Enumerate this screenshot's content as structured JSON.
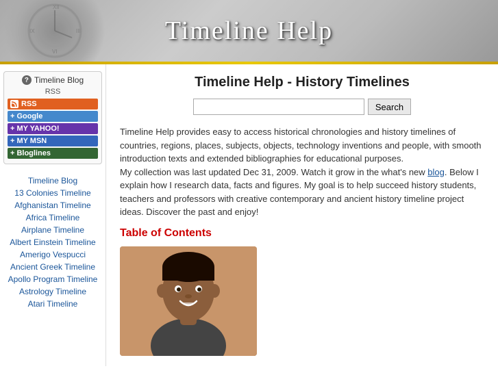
{
  "header": {
    "title": "Timeline Help"
  },
  "sidebar": {
    "blog_box_title": "Timeline Blog",
    "blog_box_subtitle": "RSS",
    "buttons": [
      {
        "label": "RSS",
        "class": "btn-rss",
        "prefix": ""
      },
      {
        "label": "Google",
        "class": "btn-google",
        "prefix": "+ "
      },
      {
        "label": "MY YAHOO!",
        "class": "btn-yahoo",
        "prefix": "+ "
      },
      {
        "label": "MY MSN",
        "class": "btn-msn",
        "prefix": "+ "
      },
      {
        "label": "Bloglines",
        "class": "btn-bloglines",
        "prefix": "+ "
      }
    ],
    "nav_links": [
      "Timeline Blog",
      "13 Colonies Timeline",
      "Afghanistan Timeline",
      "Africa Timeline",
      "Airplane Timeline",
      "Albert Einstein Timeline",
      "Amerigo Vespucci",
      "Ancient Greek Timeline",
      "Apollo Program Timeline",
      "Astrology Timeline",
      "Atari Timeline"
    ]
  },
  "main": {
    "title": "Timeline Help - History Timelines",
    "search_placeholder": "",
    "search_button_label": "Search",
    "description_p1": "Timeline Help provides easy to access historical chronologies and history timelines of countries, regions, places, subjects, objects, technology inventions and people, with smooth introduction texts and extended bibliographies for educational purposes.",
    "description_p2": "My collection was last updated Dec 31, 2009. Watch it grow in the what's new ",
    "description_link_text": "blog",
    "description_p3": ". Below I explain how I research data, facts and figures. My goal is to help succeed history students, teachers and professors with creative contemporary and ancient history timeline project ideas. Discover the past and enjoy!",
    "toc_title": "Table of Contents"
  }
}
